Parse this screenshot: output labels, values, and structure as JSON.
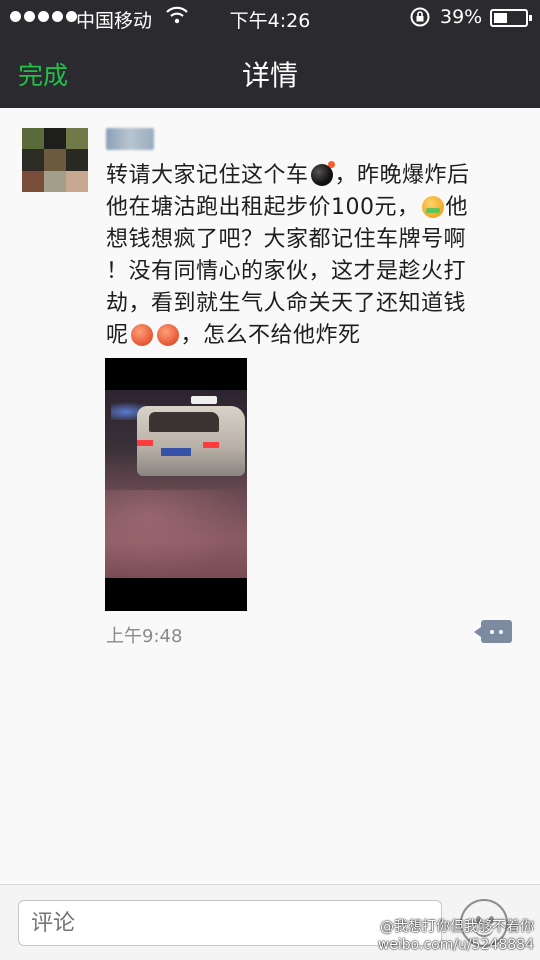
{
  "status_bar": {
    "carrier": "中国移动",
    "time": "下午4:26",
    "battery_percent": "39%",
    "battery_level": 0.39,
    "icons": [
      "signal-dots-icon",
      "wifi-icon",
      "rotation-lock-icon",
      "battery-icon"
    ]
  },
  "nav": {
    "done_label": "完成",
    "title": "详情",
    "accent_color": "#21c04b"
  },
  "post": {
    "avatar_icon": "pixelated-avatar",
    "text_lines": [
      {
        "a": "转请大家记住这个车",
        "b": "，昨晚爆炸后"
      },
      {
        "a": "他在塘沽跑出租起步价100元，",
        "b": "他"
      },
      {
        "a": "想钱想疯了吧？大家都记住车牌号啊"
      },
      {
        "a": "！没有同情心的家伙，这才是趁火打"
      },
      {
        "a": "劫，看到就生气人命关天了还知道钱"
      },
      {
        "a": "呢",
        "b": "，怎么不给他炸死"
      }
    ],
    "emojis": [
      "bomb-emoji",
      "money-mouth-emoji",
      "angry-emoji",
      "angry-emoji"
    ],
    "video_icon": "video-thumbnail",
    "time": "上午9:48",
    "comment_icon": "comment-bubble-icon"
  },
  "bottom_bar": {
    "comment_placeholder": "评论",
    "emoji_button_icon": "smiley-icon"
  },
  "watermark": {
    "line1": "@我想打你但我够不着你",
    "line2": "weibo.com/u/5248884"
  }
}
